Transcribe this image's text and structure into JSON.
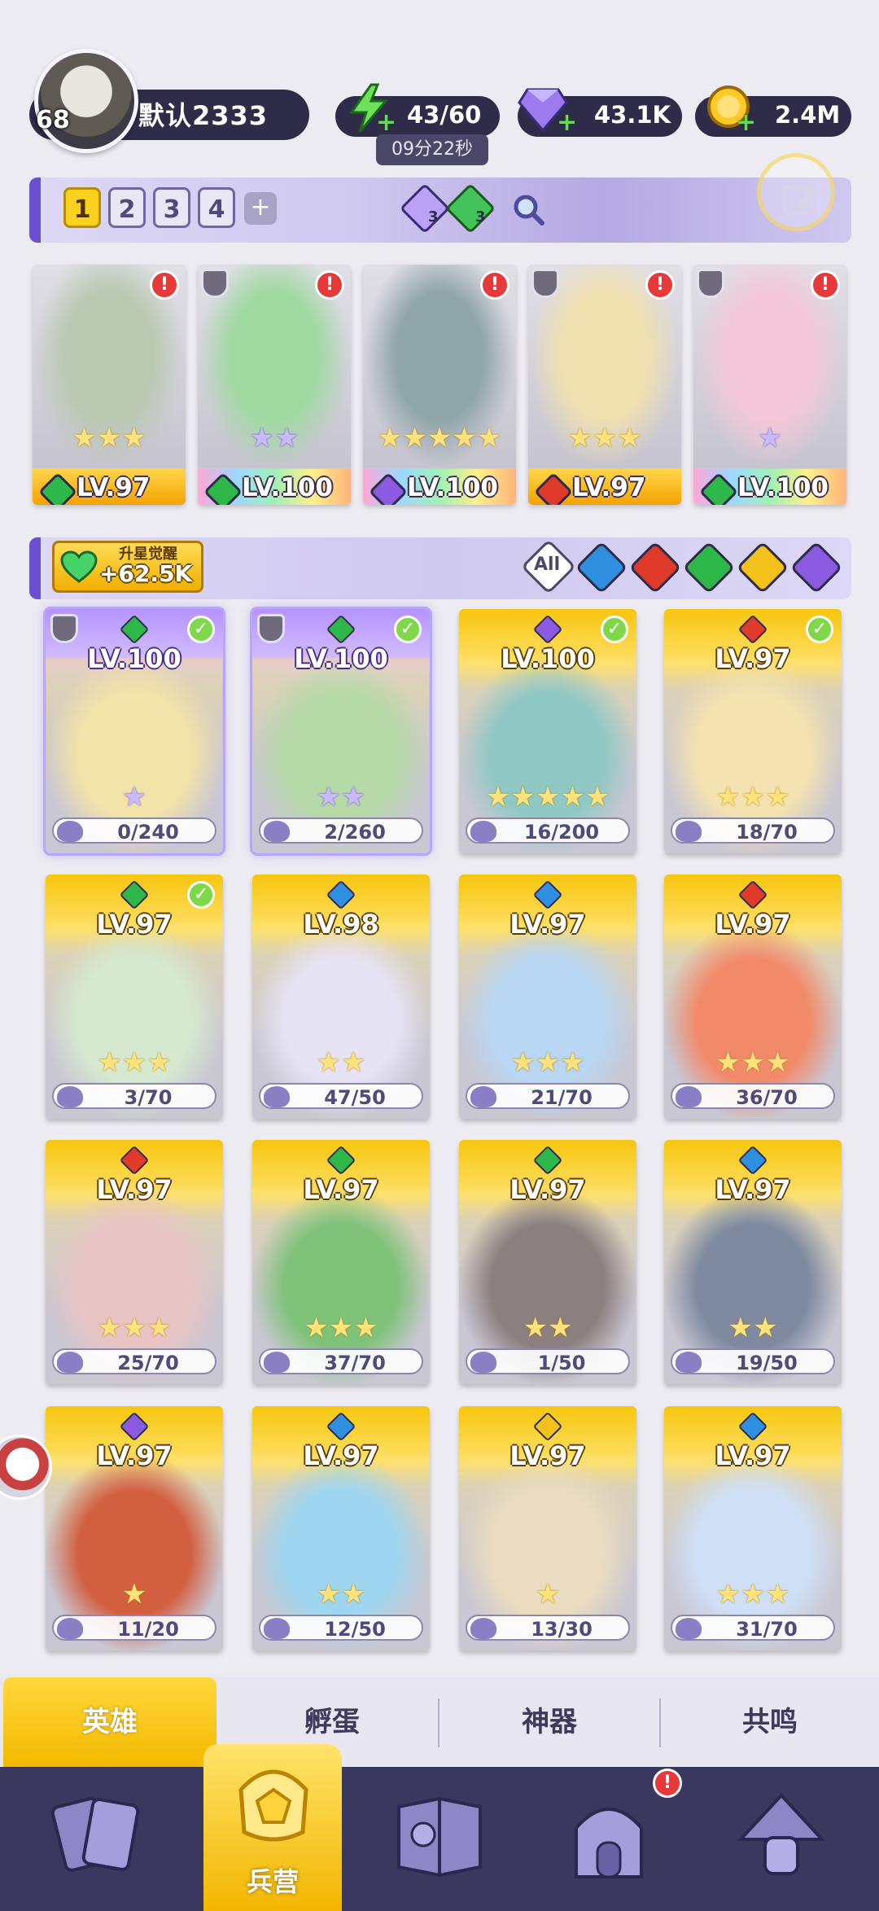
{
  "player": {
    "level": "68",
    "name": "默认2333"
  },
  "resources": {
    "energy": "43/60",
    "energy_timer": "09分22秒",
    "gems": "43.1K",
    "gold": "2.4M"
  },
  "team_slots": [
    "1",
    "2",
    "3",
    "4"
  ],
  "team_tokens": {
    "purple_count": "3",
    "green_count": "3"
  },
  "team": [
    {
      "level": "LV.97",
      "element": "green",
      "stars": "★★★",
      "star_color": "gold",
      "band": "gold",
      "alert": "!",
      "armor": false
    },
    {
      "level": "LV.100",
      "element": "green",
      "stars": "★★",
      "star_color": "purple",
      "band": "rainbow",
      "alert": "!",
      "armor": true
    },
    {
      "level": "LV.100",
      "element": "purple",
      "stars": "★★★★★",
      "star_color": "gold",
      "band": "rainbow",
      "alert": "!",
      "armor": false
    },
    {
      "level": "LV.97",
      "element": "red",
      "stars": "★★★",
      "star_color": "gold",
      "band": "gold",
      "alert": "!",
      "armor": true
    },
    {
      "level": "LV.100",
      "element": "green",
      "stars": "★",
      "star_color": "purple",
      "band": "rainbow",
      "alert": "!",
      "armor": true
    }
  ],
  "awaken": {
    "label": "升星觉醒",
    "value": "+62.5K"
  },
  "filters": {
    "all_label": "All",
    "elements": [
      "blue",
      "red",
      "green",
      "yellow",
      "purple"
    ]
  },
  "heroes": [
    {
      "level": "LV.100",
      "element": "green",
      "shards": "0/240",
      "stars": "★",
      "star_color": "purple",
      "top": "purple",
      "selected": true,
      "check": true,
      "armor": true
    },
    {
      "level": "LV.100",
      "element": "green",
      "shards": "2/260",
      "stars": "★★",
      "star_color": "purple",
      "top": "purple",
      "selected": true,
      "check": true,
      "armor": true
    },
    {
      "level": "LV.100",
      "element": "purple",
      "shards": "16/200",
      "stars": "★★★★★",
      "star_color": "gold",
      "top": "gold",
      "selected": false,
      "check": true,
      "armor": false
    },
    {
      "level": "LV.97",
      "element": "red",
      "shards": "18/70",
      "stars": "★★★",
      "star_color": "gold",
      "top": "gold",
      "selected": false,
      "check": true,
      "armor": false
    },
    {
      "level": "LV.97",
      "element": "green",
      "shards": "3/70",
      "stars": "★★★",
      "star_color": "gold",
      "top": "gold",
      "selected": false,
      "check": true,
      "armor": false
    },
    {
      "level": "LV.98",
      "element": "blue",
      "shards": "47/50",
      "stars": "★★",
      "star_color": "gold",
      "top": "gold",
      "selected": false,
      "check": false,
      "armor": false
    },
    {
      "level": "LV.97",
      "element": "blue",
      "shards": "21/70",
      "stars": "★★★",
      "star_color": "gold",
      "top": "gold",
      "selected": false,
      "check": false,
      "armor": false
    },
    {
      "level": "LV.97",
      "element": "red",
      "shards": "36/70",
      "stars": "★★★",
      "star_color": "gold",
      "top": "gold",
      "selected": false,
      "check": false,
      "armor": false
    },
    {
      "level": "LV.97",
      "element": "red",
      "shards": "25/70",
      "stars": "★★★",
      "star_color": "gold",
      "top": "gold",
      "selected": false,
      "check": false,
      "armor": false
    },
    {
      "level": "LV.97",
      "element": "green",
      "shards": "37/70",
      "stars": "★★★",
      "star_color": "gold",
      "top": "gold",
      "selected": false,
      "check": false,
      "armor": false
    },
    {
      "level": "LV.97",
      "element": "green",
      "shards": "1/50",
      "stars": "★★",
      "star_color": "gold",
      "top": "gold",
      "selected": false,
      "check": false,
      "armor": false
    },
    {
      "level": "LV.97",
      "element": "blue",
      "shards": "19/50",
      "stars": "★★",
      "star_color": "gold",
      "top": "gold",
      "selected": false,
      "check": false,
      "armor": false
    },
    {
      "level": "LV.97",
      "element": "purple",
      "shards": "11/20",
      "stars": "★",
      "star_color": "gold",
      "top": "gold",
      "selected": false,
      "check": false,
      "armor": false
    },
    {
      "level": "LV.97",
      "element": "blue",
      "shards": "12/50",
      "stars": "★★",
      "star_color": "gold",
      "top": "gold",
      "selected": false,
      "check": false,
      "armor": false
    },
    {
      "level": "LV.97",
      "element": "yellow",
      "shards": "13/30",
      "stars": "★",
      "star_color": "gold",
      "top": "gold",
      "selected": false,
      "check": false,
      "armor": false
    },
    {
      "level": "LV.97",
      "element": "blue",
      "shards": "31/70",
      "stars": "★★★",
      "star_color": "gold",
      "top": "gold",
      "selected": false,
      "check": false,
      "armor": false
    }
  ],
  "subtabs": [
    {
      "label": "英雄",
      "active": true
    },
    {
      "label": "孵蛋",
      "active": false
    },
    {
      "label": "神器",
      "active": false
    },
    {
      "label": "共鸣",
      "active": false
    }
  ],
  "nav": {
    "active_label": "兵营",
    "items": [
      "cards-icon",
      "barracks-icon",
      "book-icon",
      "castle-icon",
      "mushroom-icon"
    ],
    "castle_alert": "!"
  },
  "colors": {
    "green": "#2fb84a",
    "purple": "#8a5ae0",
    "red": "#e03a2a",
    "blue": "#2f8fe0",
    "yellow": "#f2c21a",
    "gold_band": "#f4b400",
    "accent": "#6a4fd1",
    "navbar": "#3b3860"
  }
}
